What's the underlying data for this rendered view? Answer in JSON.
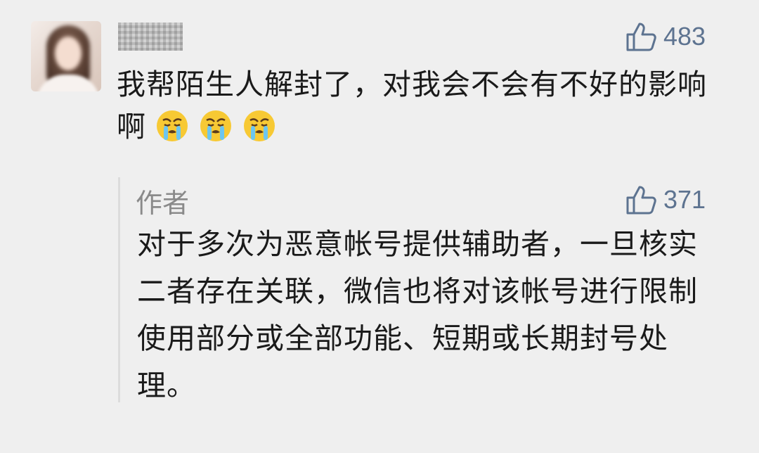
{
  "comment": {
    "text": "我帮陌生人解封了，对我会不会有不好的影响啊",
    "emojis": [
      "crying-face-icon",
      "crying-face-icon",
      "crying-face-icon"
    ],
    "like_count": "483"
  },
  "reply": {
    "author": "作者",
    "like_count": "371",
    "text": "对于多次为恶意帐号提供辅助者，一旦核实二者存在关联，微信也将对该帐号进行限制使用部分或全部功能、短期或长期封号处理。"
  },
  "colors": {
    "background": "#efefef",
    "like_blue": "#5d7390",
    "reply_border": "#dcdcdc",
    "author_gray": "#8a8a8a"
  }
}
